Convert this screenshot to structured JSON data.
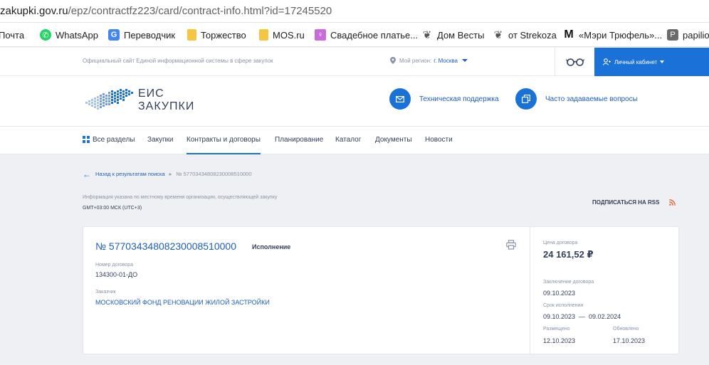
{
  "browser": {
    "url_host": "zakupki.gov.ru",
    "url_path": "/epz/contractfz223/card/contract-info.html?id=17245520",
    "bookmarks": [
      {
        "label": "Почта",
        "icon": "mail-icon"
      },
      {
        "label": "WhatsApp",
        "icon": "whatsapp-icon"
      },
      {
        "label": "Переводчик",
        "icon": "translate-icon"
      },
      {
        "label": "Торжество",
        "icon": "folder-icon"
      },
      {
        "label": "MOS.ru",
        "icon": "folder-icon"
      },
      {
        "label": "Свадебное платье...",
        "icon": "dress-icon"
      },
      {
        "label": "Дом Весты",
        "icon": "leaf-icon"
      },
      {
        "label": "от Strekoza",
        "icon": "leaf-icon"
      },
      {
        "label": "«Мэри Трюфель»...",
        "icon": "m-icon"
      },
      {
        "label": "papilio",
        "icon": "p-icon"
      }
    ]
  },
  "topbar": {
    "official": "Официальный сайт Единой информационной системы в сфере закупок",
    "region_label": "Мой регион:",
    "region_value": "г. Москва",
    "cabinet": "Личный кабинет"
  },
  "header": {
    "logo_line1": "ЕИС",
    "logo_line2": "ЗАКУПКИ",
    "support": "Техническая поддержка",
    "faq": "Часто задаваемые вопросы"
  },
  "nav": {
    "items": [
      "Все разделы",
      "Закупки",
      "Контракты и договоры",
      "Планирование",
      "Каталог",
      "Документы",
      "Новости"
    ],
    "active_index": 2
  },
  "breadcrumb": {
    "back": "Назад к результатам поиска",
    "current": "№ 57703434808230008510000"
  },
  "timezone": {
    "note": "Информация указана по местному времени организации, осуществляющей закупку",
    "value": "GMT+03:00 МСК (UTC+3)"
  },
  "rss": "ПОДПИСАТЬСЯ НА RSS",
  "contract": {
    "number": "№ 57703434808230008510000",
    "status": "Исполнение",
    "contract_no_label": "Номер договора",
    "contract_no": "134300-01-ДО",
    "customer_label": "Заказчик",
    "customer": "МОСКОВСКИЙ ФОНД РЕНОВАЦИИ ЖИЛОЙ ЗАСТРОЙКИ",
    "price_label": "Цена договора",
    "price": "24 161,52 ₽",
    "concluded_label": "Заключение договора",
    "concluded": "09.10.2023",
    "term_label": "Срок исполнения",
    "term": "09.10.2023  —  09.02.2024",
    "posted_label": "Размещено",
    "posted": "12.10.2023",
    "updated_label": "Обновлено",
    "updated": "17.10.2023"
  },
  "colors": {
    "accent": "#1a72d9",
    "link": "#1c5fbd",
    "text": "#334059",
    "muted": "#8a93a6",
    "background": "#eef0f3",
    "rss": "#e8602c"
  }
}
